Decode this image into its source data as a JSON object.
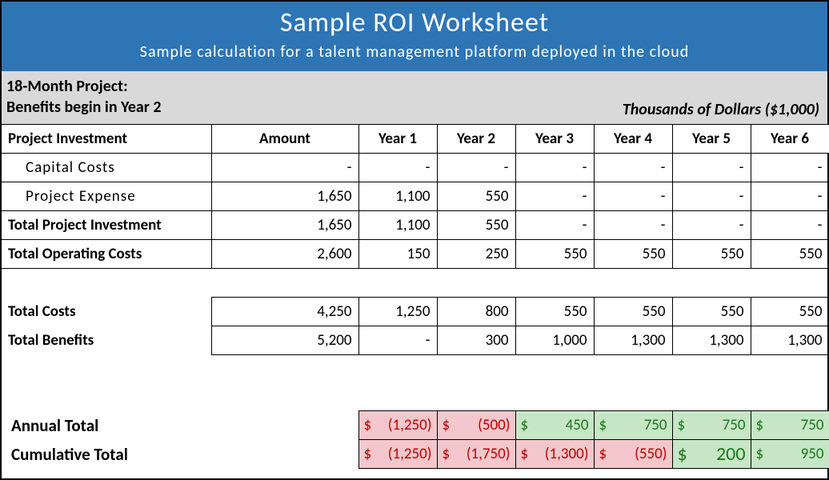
{
  "header": {
    "title": "Sample ROI Worksheet",
    "subtitle": "Sample calculation for a talent management platform deployed in the cloud"
  },
  "subheader": {
    "line1": "18-Month Project:",
    "line2": "Benefits begin in Year 2",
    "right": "Thousands of Dollars ($1,000)"
  },
  "columns": {
    "label": "Project Investment",
    "amount": "Amount",
    "y1": "Year 1",
    "y2": "Year 2",
    "y3": "Year 3",
    "y4": "Year 4",
    "y5": "Year 5",
    "y6": "Year 6"
  },
  "rows": {
    "capital": {
      "label": "Capital Costs",
      "amount": "-",
      "y1": "-",
      "y2": "-",
      "y3": "-",
      "y4": "-",
      "y5": "-",
      "y6": "-"
    },
    "expense": {
      "label": "Project Expense",
      "amount": "1,650",
      "y1": "1,100",
      "y2": "550",
      "y3": "-",
      "y4": "-",
      "y5": "-",
      "y6": "-"
    },
    "totalpi": {
      "label": "Total Project Investment",
      "amount": "1,650",
      "y1": "1,100",
      "y2": "550",
      "y3": "-",
      "y4": "-",
      "y5": "-",
      "y6": "-"
    },
    "opcosts": {
      "label": "Total Operating Costs",
      "amount": "2,600",
      "y1": "150",
      "y2": "250",
      "y3": "550",
      "y4": "550",
      "y5": "550",
      "y6": "550"
    },
    "totalcosts": {
      "label": "Total Costs",
      "amount": "4,250",
      "y1": "1,250",
      "y2": "800",
      "y3": "550",
      "y4": "550",
      "y5": "550",
      "y6": "550"
    },
    "totalbenefits": {
      "label": "Total Benefits",
      "amount": "5,200",
      "y1": "-",
      "y2": "300",
      "y3": "1,000",
      "y4": "1,300",
      "y5": "1,300",
      "y6": "1,300"
    }
  },
  "totals": {
    "annual": {
      "label": "Annual Total",
      "y1": {
        "sign": "neg",
        "val": "(1,250)"
      },
      "y2": {
        "sign": "neg",
        "val": "(500)"
      },
      "y3": {
        "sign": "pos",
        "val": "450"
      },
      "y4": {
        "sign": "pos",
        "val": "750"
      },
      "y5": {
        "sign": "pos",
        "val": "750"
      },
      "y6": {
        "sign": "pos",
        "val": "750"
      }
    },
    "cumulative": {
      "label": "Cumulative Total",
      "y1": {
        "sign": "neg",
        "val": "(1,250)"
      },
      "y2": {
        "sign": "neg",
        "val": "(1,750)"
      },
      "y3": {
        "sign": "neg",
        "val": "(1,300)"
      },
      "y4": {
        "sign": "neg",
        "val": "(550)"
      },
      "y5": {
        "sign": "pos",
        "val": "200",
        "big": true
      },
      "y6": {
        "sign": "pos",
        "val": "950"
      }
    }
  },
  "chart_data": {
    "type": "table",
    "title": "Sample ROI Worksheet",
    "units": "Thousands of Dollars ($1,000)",
    "columns": [
      "Amount",
      "Year 1",
      "Year 2",
      "Year 3",
      "Year 4",
      "Year 5",
      "Year 6"
    ],
    "rows": [
      {
        "name": "Capital Costs",
        "values": [
          0,
          0,
          0,
          0,
          0,
          0,
          0
        ]
      },
      {
        "name": "Project Expense",
        "values": [
          1650,
          1100,
          550,
          0,
          0,
          0,
          0
        ]
      },
      {
        "name": "Total Project Investment",
        "values": [
          1650,
          1100,
          550,
          0,
          0,
          0,
          0
        ]
      },
      {
        "name": "Total Operating Costs",
        "values": [
          2600,
          150,
          250,
          550,
          550,
          550,
          550
        ]
      },
      {
        "name": "Total Costs",
        "values": [
          4250,
          1250,
          800,
          550,
          550,
          550,
          550
        ]
      },
      {
        "name": "Total Benefits",
        "values": [
          5200,
          0,
          300,
          1000,
          1300,
          1300,
          1300
        ]
      },
      {
        "name": "Annual Total",
        "values": [
          null,
          -1250,
          -500,
          450,
          750,
          750,
          750
        ]
      },
      {
        "name": "Cumulative Total",
        "values": [
          null,
          -1250,
          -1750,
          -1300,
          -550,
          200,
          950
        ]
      }
    ]
  }
}
